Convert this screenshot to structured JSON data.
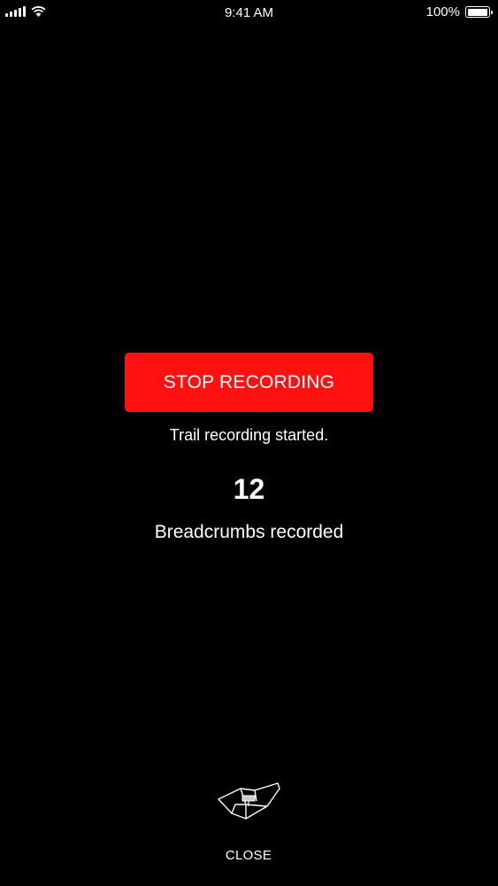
{
  "status_bar": {
    "time": "9:41 AM",
    "battery_percent": "100%",
    "battery_level": 1.0,
    "signal_icon": "cellular-signal-icon",
    "wifi_icon": "wifi-icon",
    "battery_icon": "battery-icon"
  },
  "recording": {
    "stop_button_label": "STOP RECORDING",
    "status_message": "Trail recording started.",
    "breadcrumb_count": "12",
    "breadcrumb_label": "Breadcrumbs recorded"
  },
  "close": {
    "icon": "folded-map-icon",
    "label": "CLOSE"
  },
  "colors": {
    "background": "#000000",
    "accent": "#ff1111",
    "text": "#ffffff"
  }
}
